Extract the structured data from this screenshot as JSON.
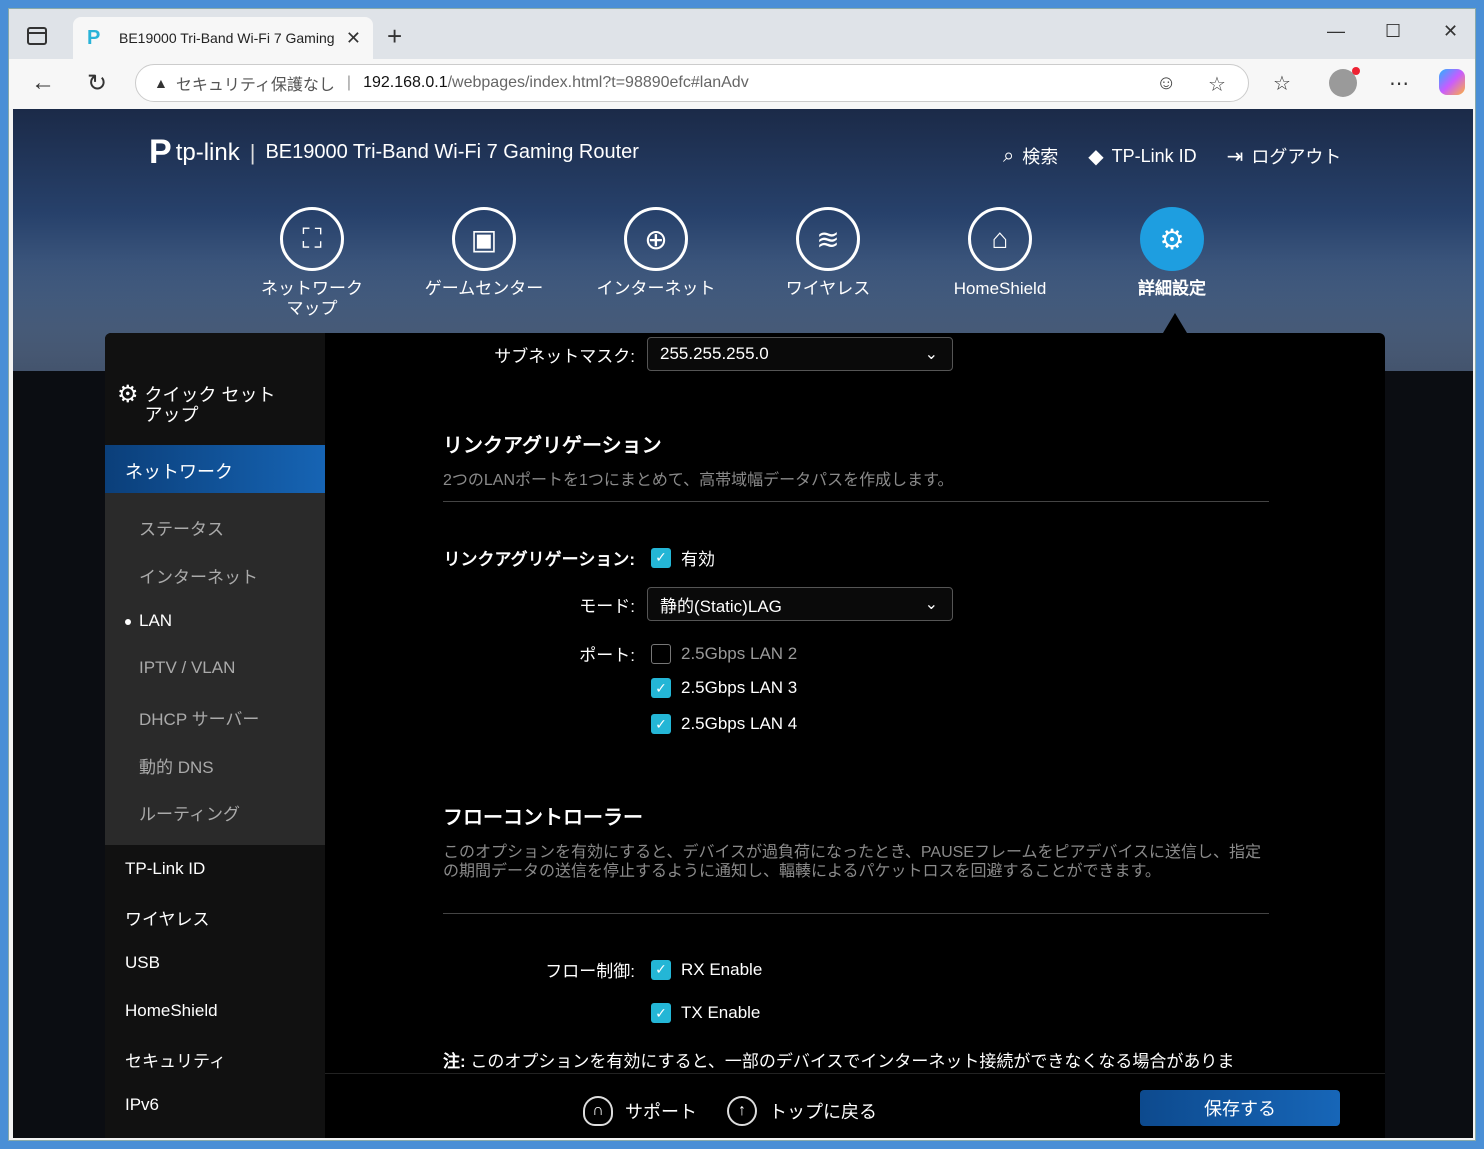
{
  "browser": {
    "tab_title": "BE19000 Tri-Band Wi-Fi 7 Gaming",
    "security_label": "セキュリティ保護なし",
    "url_host": "192.168.0.1",
    "url_path": "/webpages/index.html?t=98890efc#lanAdv"
  },
  "header": {
    "brand": "tp-link",
    "model": "BE19000 Tri-Band Wi-Fi 7 Gaming Router",
    "search": "検索",
    "tplink_id": "TP-Link ID",
    "logout": "ログアウト"
  },
  "main_nav": [
    {
      "label": "ネットワーク\nマップ",
      "icon": "network-map-icon"
    },
    {
      "label": "ゲームセンター",
      "icon": "gamepad-icon"
    },
    {
      "label": "インターネット",
      "icon": "globe-icon"
    },
    {
      "label": "ワイヤレス",
      "icon": "wifi-icon"
    },
    {
      "label": "HomeShield",
      "icon": "home-shield-icon"
    },
    {
      "label": "詳細設定",
      "icon": "advanced-gear-icon"
    }
  ],
  "sidebar": {
    "quick_setup": "クイック セット\nアップ",
    "network": "ネットワーク",
    "sub_items": [
      "ステータス",
      "インターネット",
      "LAN",
      "IPTV / VLAN",
      "DHCP サーバー",
      "動的 DNS",
      "ルーティング"
    ],
    "items": [
      "TP-Link ID",
      "ワイヤレス",
      "USB",
      "HomeShield",
      "セキュリティ",
      "IPv6"
    ]
  },
  "content": {
    "subnet_label": "サブネットマスク:",
    "subnet_value": "255.255.255.0",
    "link_agg": {
      "title": "リンクアグリゲーション",
      "desc": "2つのLANポートを1つにまとめて、高帯域幅データパスを作成します。",
      "toggle_label": "リンクアグリゲーション:",
      "toggle_value": "有効",
      "mode_label": "モード:",
      "mode_value": "静的(Static)LAG",
      "port_label": "ポート:",
      "ports": [
        "2.5Gbps LAN 2",
        "2.5Gbps LAN 3",
        "2.5Gbps LAN 4"
      ]
    },
    "flow": {
      "title": "フローコントローラー",
      "desc": "このオプションを有効にすると、デバイスが過負荷になったとき、PAUSEフレームをピアデバイスに送信し、指定の期間データの送信を停止するように通知し、輻輳によるパケットロスを回避することができます。",
      "label": "フロー制御:",
      "rx": "RX Enable",
      "tx": "TX Enable"
    },
    "note_label": "注:",
    "note_text": "このオプションを有効にすると、一部のデバイスでインターネット接続ができなくなる場合がありま"
  },
  "footer": {
    "support": "サポート",
    "back_to_top": "トップに戻る",
    "save": "保存する"
  },
  "colors": {
    "accent": "#24b6d6",
    "save": "#1766b8"
  }
}
